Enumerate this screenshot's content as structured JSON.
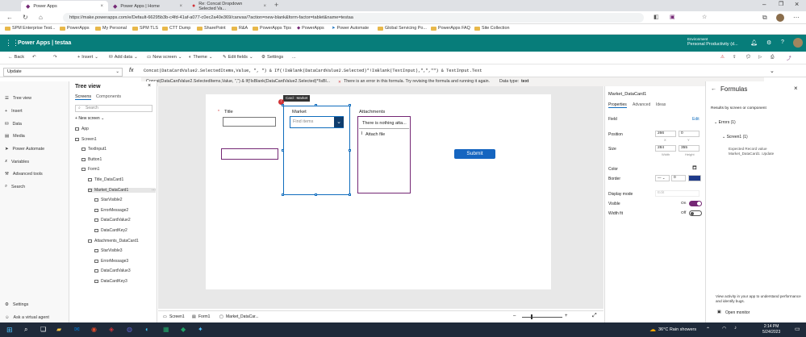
{
  "browser": {
    "tabs": [
      {
        "label": "Power Apps"
      },
      {
        "label": "Power Apps | Home"
      },
      {
        "label": "Re: Concat Dropdown Selected Va..."
      }
    ],
    "url": "https://make.powerapps.com/e/Default-66295b3b-c4fd-41af-a077-c0ec2a40e369/canvas/?action=new-blank&form-factor=tablet&name=testaa",
    "bookmarks": [
      "SPM Enterprise Test...",
      "PowerApps",
      "My Personal",
      "SPM TLS",
      "CTT Dump",
      "SharePoint",
      "R&A",
      "PowerApps Tips",
      "PowerApps",
      "Power Automate",
      "Global Servicing Po...",
      "PowerApps FAQ",
      "Site Collection"
    ]
  },
  "app": {
    "title": "Power Apps  |  testaa",
    "env_label": "Environment",
    "env_name": "Personal Productivity (d..."
  },
  "commandbar": {
    "back": "Back",
    "insert": "Insert",
    "add_data": "Add data",
    "new_screen": "New screen",
    "theme": "Theme",
    "edit_fields": "Edit fields",
    "settings": "Settings",
    "more": "..."
  },
  "formula": {
    "property": "Update",
    "fx": "fx",
    "text": "Concat(DataCardValue2.SelectedItems,Value, \", \") & If(!IsBlank(DataCardValue2.Selected)*!IsBlank(TextInput),\",\",\"\") & TextInput.Text",
    "error_expr": "Concat(DataCardValue2.SelectedItems,Value, \",\") & If(!IsBlank(DataCardValue2.Selected)*!IsBl...",
    "error_msg": "There is an error in this formula. Try revising the formula and running it again.",
    "data_type_label": "Data type:",
    "data_type_value": "text"
  },
  "rail": [
    "Tree view",
    "Insert",
    "Data",
    "Media",
    "Power Automate",
    "Variables",
    "Advanced tools",
    "Search",
    "Settings",
    "Ask a virtual agent"
  ],
  "tree": {
    "title": "Tree view",
    "tabs": [
      "Screens",
      "Components"
    ],
    "search_placeholder": "Search",
    "new_screen": "New screen",
    "nodes": [
      {
        "label": "App",
        "indent": 0
      },
      {
        "label": "Screen1",
        "indent": 0
      },
      {
        "label": "TextInput1",
        "indent": 1
      },
      {
        "label": "Button1",
        "indent": 1
      },
      {
        "label": "Form1",
        "indent": 1
      },
      {
        "label": "Title_DataCard1",
        "indent": 2
      },
      {
        "label": "Market_DataCard1",
        "indent": 2,
        "selected": true
      },
      {
        "label": "StarVisible2",
        "indent": 3
      },
      {
        "label": "ErrorMessage2",
        "indent": 3
      },
      {
        "label": "DataCardValue2",
        "indent": 3
      },
      {
        "label": "DataCardKey2",
        "indent": 3
      },
      {
        "label": "Attachments_DataCard1",
        "indent": 2
      },
      {
        "label": "StarVisible3",
        "indent": 3
      },
      {
        "label": "ErrorMessage3",
        "indent": 3
      },
      {
        "label": "DataCardValue3",
        "indent": 3
      },
      {
        "label": "DataCardKey3",
        "indent": 3
      }
    ]
  },
  "canvas": {
    "title_label": "Title",
    "title_star": "*",
    "market_label": "Market",
    "market_tooltip": "Card : Market",
    "market_placeholder": "Find items",
    "attachments_label": "Attachments",
    "attachments_empty": "There is nothing atta...",
    "attach_file": "Attach file",
    "submit": "Submit"
  },
  "props": {
    "name": "Market_DataCard1",
    "tabs": [
      "Properties",
      "Advanced",
      "Ideas"
    ],
    "field_label": "Field",
    "field_edit": "Edit",
    "position_label": "Position",
    "position_x": "266",
    "position_y": "0",
    "x_label": "X",
    "y_label": "Y",
    "size_label": "Size",
    "size_w": "284",
    "size_h": "355",
    "w_label": "Width",
    "h_label": "Height",
    "color_label": "Color",
    "border_label": "Border",
    "border_value": "0",
    "display_mode_label": "Display mode",
    "display_mode_value": "Edit",
    "visible_label": "Visible",
    "visible_value": "On",
    "width_fit_label": "Width fit",
    "width_fit_value": "Off"
  },
  "formulas_pane": {
    "title": "Formulas",
    "subtitle": "Results by screen or component",
    "errors": "Errors (1)",
    "screen": "Screen1 (1)",
    "error_detail": "Expected Record value Market_DataCard1 .Update",
    "footer_text": "View activity in your app to understand performance and identify bugs.",
    "monitor": "Open monitor"
  },
  "status": {
    "screen": "Screen1",
    "form": "Form1",
    "card": "Market_DataCar..."
  },
  "taskbar": {
    "weather": "36°C  Rain showers",
    "time": "2:14 PM",
    "date": "5/24/2023"
  },
  "colors": {
    "brand": "#077d7a",
    "accent": "#742774",
    "selection": "#0f6cbd",
    "error": "#d13438"
  }
}
